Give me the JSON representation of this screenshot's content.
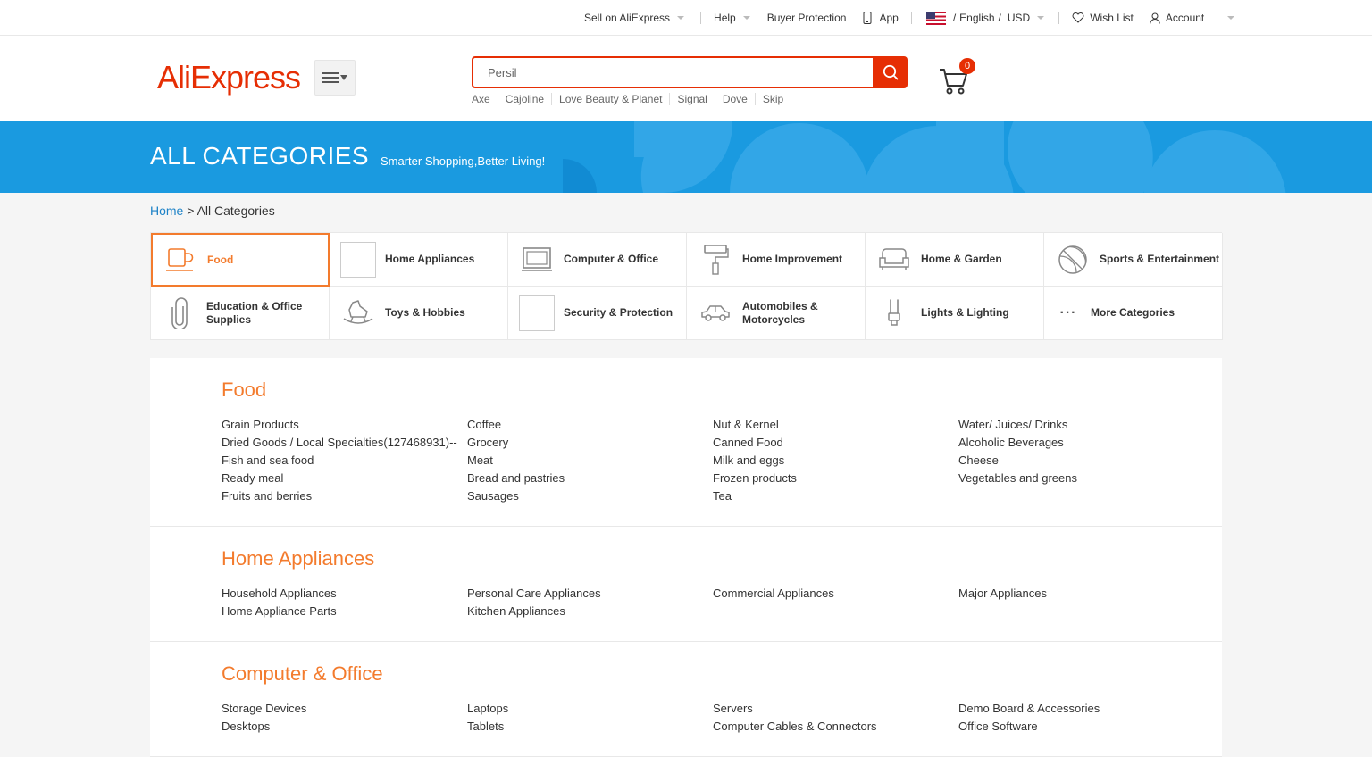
{
  "topbar": {
    "sell": "Sell on AliExpress",
    "help": "Help",
    "buyer_protection": "Buyer Protection",
    "app": "App",
    "language_prefix": "/",
    "language": "English",
    "lang_sep": "/",
    "currency": "USD",
    "wishlist": "Wish List",
    "account": "Account"
  },
  "header": {
    "logo": "AliExpress",
    "search_placeholder": "Persil",
    "hot_searches": [
      "Axe",
      "Cajoline",
      "Love Beauty & Planet",
      "Signal",
      "Dove",
      "Skip"
    ],
    "cart_count": "0"
  },
  "banner": {
    "title": "ALL CATEGORIES",
    "subtitle": "Smarter Shopping,Better Living!"
  },
  "breadcrumb": {
    "home": "Home",
    "sep": ">",
    "current": "All Categories"
  },
  "categories": [
    {
      "label": "Food",
      "icon": "cup-icon"
    },
    {
      "label": "Home Appliances",
      "icon": "image-placeholder"
    },
    {
      "label": "Computer & Office",
      "icon": "monitor-icon"
    },
    {
      "label": "Home Improvement",
      "icon": "paint-roller-icon"
    },
    {
      "label": "Home & Garden",
      "icon": "sofa-icon"
    },
    {
      "label": "Sports & Entertainment",
      "icon": "ball-icon"
    },
    {
      "label": "Education & Office Supplies",
      "icon": "paperclip-icon"
    },
    {
      "label": "Toys & Hobbies",
      "icon": "rocking-horse-icon"
    },
    {
      "label": "Security & Protection",
      "icon": "image-placeholder"
    },
    {
      "label": "Automobiles & Motorcycles",
      "icon": "car-icon"
    },
    {
      "label": "Lights & Lighting",
      "icon": "bulb-icon"
    },
    {
      "label": "More Categories",
      "icon": "more-icon",
      "glyph": "···"
    }
  ],
  "sections": [
    {
      "title": "Food",
      "items": [
        "Grain Products",
        "Coffee",
        "Nut & Kernel",
        "Water/ Juices/ Drinks",
        "Dried Goods / Local Specialties(127468931)--",
        "Grocery",
        "Canned Food",
        "Alcoholic Beverages",
        "Fish and sea food",
        "Meat",
        "Milk and eggs",
        "Cheese",
        "Ready meal",
        "Bread and pastries",
        "Frozen products",
        "Vegetables and greens",
        "Fruits and berries",
        "Sausages",
        "Tea"
      ]
    },
    {
      "title": "Home Appliances",
      "items": [
        "Household Appliances",
        "Personal Care Appliances",
        "Commercial Appliances",
        "Major Appliances",
        "Home Appliance Parts",
        "Kitchen Appliances"
      ]
    },
    {
      "title": "Computer & Office",
      "items": [
        "Storage Devices",
        "Laptops",
        "Servers",
        "Demo Board & Accessories",
        "Desktops",
        "Tablets",
        "Computer Cables & Connectors",
        "Office Software"
      ]
    }
  ],
  "colors": {
    "brand": "#e62e04",
    "accent": "#f37b2d",
    "banner": "#1a9ae0",
    "link": "#1d82c7"
  }
}
